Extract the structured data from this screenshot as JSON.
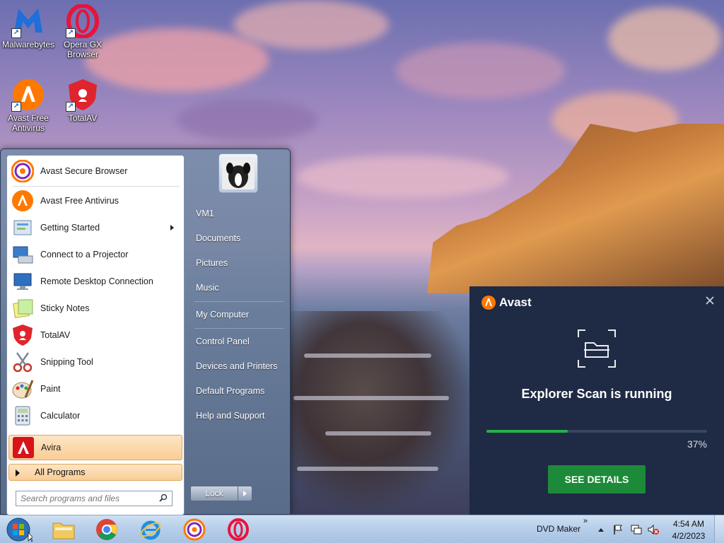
{
  "desktop": {
    "icons": [
      {
        "label": "Malwarebytes",
        "icon": "malwarebytes-icon"
      },
      {
        "label": "Opera GX\nBrowser",
        "icon": "opera-gx-icon"
      },
      {
        "label": "Avast Free\nAntivirus",
        "icon": "avast-icon"
      },
      {
        "label": "TotalAV",
        "icon": "totalav-icon"
      }
    ]
  },
  "start_menu": {
    "programs": [
      {
        "label": "Avast Secure Browser",
        "icon": "avast-browser-icon"
      },
      {
        "label": "Avast Free Antivirus",
        "icon": "avast-icon"
      },
      {
        "label": "Getting Started",
        "icon": "getting-started-icon",
        "submenu": true
      },
      {
        "label": "Connect to a Projector",
        "icon": "projector-icon"
      },
      {
        "label": "Remote Desktop Connection",
        "icon": "remote-desktop-icon"
      },
      {
        "label": "Sticky Notes",
        "icon": "sticky-notes-icon"
      },
      {
        "label": "TotalAV",
        "icon": "totalav-icon"
      },
      {
        "label": "Snipping Tool",
        "icon": "scissors-icon"
      },
      {
        "label": "Paint",
        "icon": "paint-icon"
      },
      {
        "label": "Calculator",
        "icon": "calculator-icon"
      },
      {
        "label": "Avira",
        "icon": "avira-icon",
        "highlighted": true
      }
    ],
    "all_programs": "All Programs",
    "search_placeholder": "Search programs and files",
    "right_links": [
      "VM1",
      "Documents",
      "Pictures",
      "Music",
      "My Computer",
      "Control Panel",
      "Devices and Printers",
      "Default Programs",
      "Help and Support"
    ],
    "lock_label": "Lock"
  },
  "avast_popup": {
    "brand": "Avast",
    "message": "Explorer Scan is running",
    "progress_percent": 37,
    "progress_label": "37%",
    "button_label": "SEE DETAILS",
    "accent": "#28b04a",
    "button_color": "#1d8a3a",
    "background": "#1f2a44"
  },
  "taskbar": {
    "apps": [
      "file-explorer-icon",
      "chrome-icon",
      "internet-explorer-icon",
      "avast-browser-icon",
      "opera-icon"
    ],
    "toolbar_label": "DVD Maker",
    "toolbar_chevron": "»",
    "time": "4:54 AM",
    "date": "4/2/2023"
  }
}
